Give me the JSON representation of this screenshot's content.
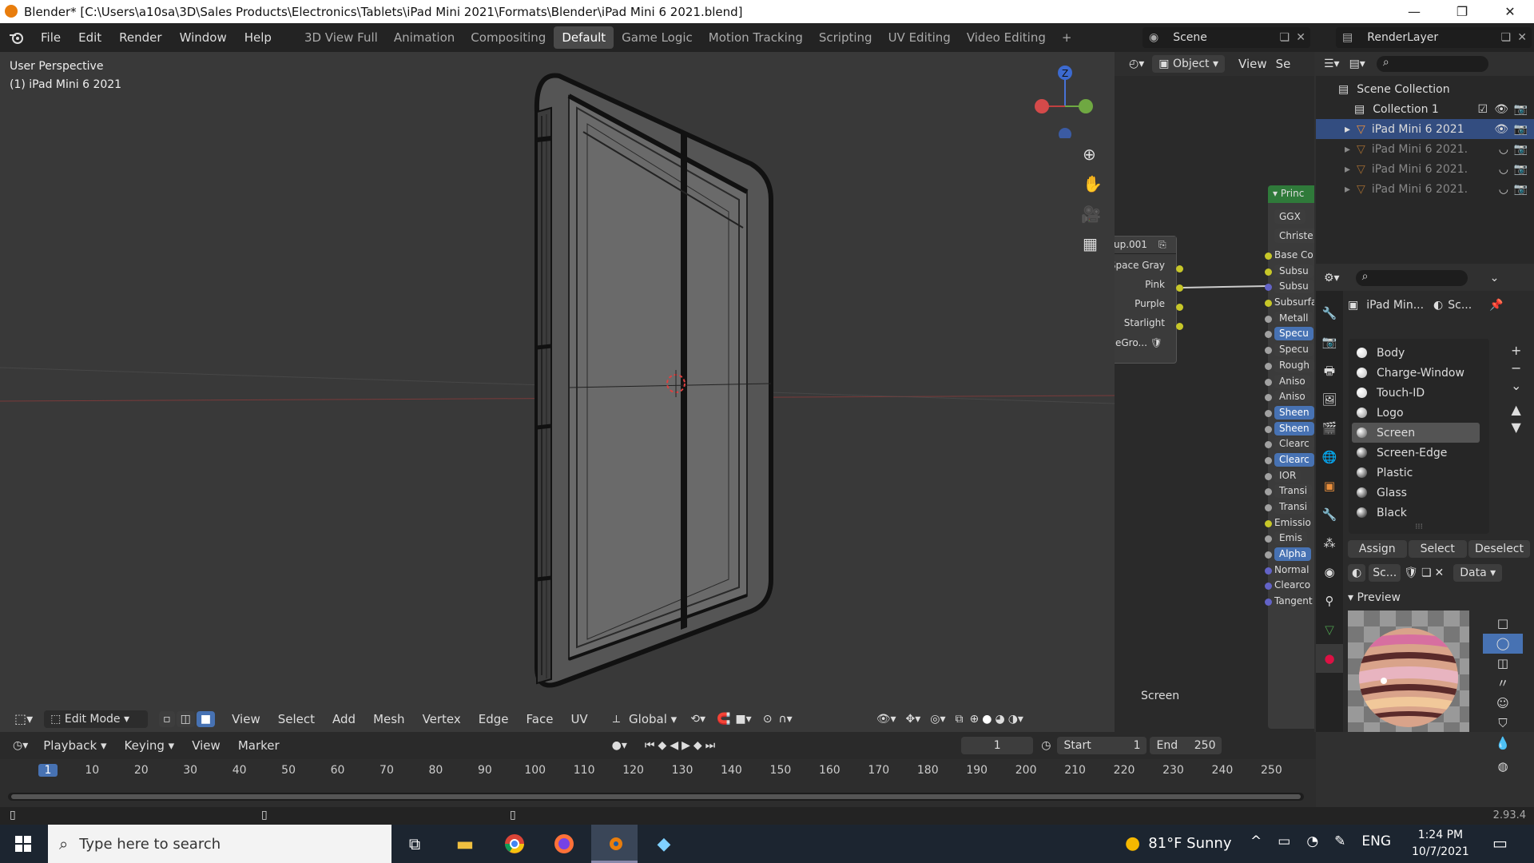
{
  "window": {
    "title": "Blender* [C:\\Users\\a10sa\\3D\\Sales Products\\Electronics\\Tablets\\iPad Mini 2021\\Formats\\Blender\\iPad Mini 6 2021.blend]",
    "minimize": "—",
    "maximize": "❐",
    "close": "✕"
  },
  "menus": [
    "File",
    "Edit",
    "Render",
    "Window",
    "Help"
  ],
  "workspaces": [
    "3D View Full",
    "Animation",
    "Compositing",
    "Default",
    "Game Logic",
    "Motion Tracking",
    "Scripting",
    "UV Editing",
    "Video Editing",
    "+"
  ],
  "active_workspace": "Default",
  "scene": {
    "label": "Scene",
    "render_layer": "RenderLayer"
  },
  "viewport": {
    "perspective": "User Perspective",
    "object": "(1) iPad Mini 6 2021",
    "gizmo_z": "Z",
    "header": {
      "mode": "Edit Mode",
      "menus": [
        "View",
        "Select",
        "Add",
        "Mesh",
        "Vertex",
        "Edge",
        "Face",
        "UV"
      ],
      "orientation": "Global"
    }
  },
  "node_editor": {
    "header": {
      "object": "Object",
      "view": "View",
      "select": "Se"
    },
    "group": {
      "title": "up.001",
      "outputs": [
        "Space Gray",
        "Pink",
        "Purple",
        "Starlight"
      ],
      "bottom": "eGro..."
    },
    "principled": {
      "title": "Princ",
      "dist": "GGX",
      "sss": "Christe",
      "inputs": [
        "Base Co",
        "Subsu",
        "Subsu",
        "Subsurfa",
        "Metall",
        "Specu",
        "Specu",
        "Rough",
        "Aniso",
        "Aniso",
        "Sheen",
        "Sheen",
        "Clearc",
        "Clearc",
        "IOR",
        "Transi",
        "Transi",
        "Emissio",
        "Emis",
        "Alpha",
        "Normal",
        "Clearco",
        "Tangent"
      ]
    },
    "footer": "Screen"
  },
  "outliner": {
    "scene_collection": "Scene Collection",
    "collection": "Collection 1",
    "items": [
      "iPad Mini 6 2021",
      "iPad Mini 6 2021.",
      "iPad Mini 6 2021.",
      "iPad Mini 6 2021."
    ]
  },
  "properties": {
    "object_name": "iPad Min...",
    "material_short": "Sc...",
    "materials": [
      {
        "name": "Body",
        "color": "#cfcfcf"
      },
      {
        "name": "Charge-Window",
        "color": "#bcbcbc"
      },
      {
        "name": "Touch-ID",
        "color": "#d0d0d0"
      },
      {
        "name": "Logo",
        "color": "#888888"
      },
      {
        "name": "Screen",
        "color": "#555555"
      },
      {
        "name": "Screen-Edge",
        "color": "#1e1e1e"
      },
      {
        "name": "Plastic",
        "color": "#262626"
      },
      {
        "name": "Glass",
        "color": "#1e1e1e"
      },
      {
        "name": "Black",
        "color": "#111111"
      }
    ],
    "selected_material": "Screen",
    "buttons": {
      "assign": "Assign",
      "select": "Select",
      "deselect": "Deselect"
    },
    "slot": {
      "name": "Sc...",
      "link": "Data"
    },
    "preview_label": "Preview"
  },
  "timeline": {
    "menus": [
      "Playback",
      "Keying",
      "View",
      "Marker"
    ],
    "current_frame": "1",
    "start_label": "Start",
    "start": "1",
    "end_label": "End",
    "end": "250",
    "ticks": [
      "1",
      "10",
      "20",
      "30",
      "40",
      "50",
      "60",
      "70",
      "80",
      "90",
      "100",
      "110",
      "120",
      "130",
      "140",
      "150",
      "160",
      "170",
      "180",
      "190",
      "200",
      "210",
      "220",
      "230",
      "240",
      "250"
    ]
  },
  "status": {
    "version": "2.93.4"
  },
  "taskbar": {
    "search_placeholder": "Type here to search",
    "weather": "81°F  Sunny",
    "lang": "ENG",
    "time": "1:24 PM",
    "date": "10/7/2021"
  },
  "colors": {
    "accent": "#4772b3",
    "bg": "#303030",
    "header": "#232323"
  }
}
